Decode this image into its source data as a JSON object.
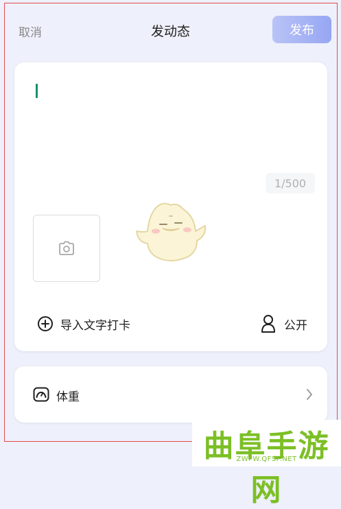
{
  "header": {
    "cancel_label": "取消",
    "title": "发动态",
    "publish_label": "发布"
  },
  "composer": {
    "char_count": "1/500",
    "import_label": "导入文字打卡",
    "visibility_label": "公开"
  },
  "weight": {
    "label": "体重"
  },
  "watermark": {
    "brand": "曲阜手游网",
    "url": "ZWFW.QFSP.NET"
  },
  "colors": {
    "accent": "#96a6f2",
    "caret": "#1a8f6e",
    "background": "#eef0fb",
    "watermark": "#7cbf26"
  }
}
